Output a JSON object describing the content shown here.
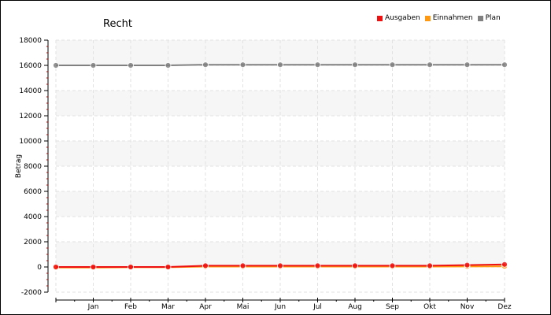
{
  "chart_data": {
    "type": "line",
    "title": "Recht",
    "xlabel": "",
    "ylabel": "Betrag",
    "categories": [
      "",
      "Jan",
      "Feb",
      "Mar",
      "Apr",
      "Mai",
      "Jun",
      "Jul",
      "Aug",
      "Sep",
      "Okt",
      "Nov",
      "Dez"
    ],
    "ylim": [
      -2000,
      18000
    ],
    "yticks": [
      -2000,
      0,
      2000,
      4000,
      6000,
      8000,
      10000,
      12000,
      14000,
      16000,
      18000
    ],
    "grid": true,
    "legend_position": "top-right",
    "series": [
      {
        "name": "Ausgaben",
        "color": "#ee1111",
        "values": [
          0,
          0,
          0,
          0,
          100,
          100,
          100,
          100,
          100,
          100,
          100,
          150,
          200
        ]
      },
      {
        "name": "Einnahmen",
        "color": "#ff9911",
        "values": [
          -50,
          -50,
          -20,
          -20,
          30,
          30,
          30,
          30,
          30,
          30,
          30,
          40,
          50
        ]
      },
      {
        "name": "Plan",
        "color": "#808080",
        "values": [
          16000,
          16000,
          16000,
          16000,
          16050,
          16050,
          16050,
          16050,
          16050,
          16050,
          16050,
          16050,
          16050
        ]
      }
    ]
  }
}
